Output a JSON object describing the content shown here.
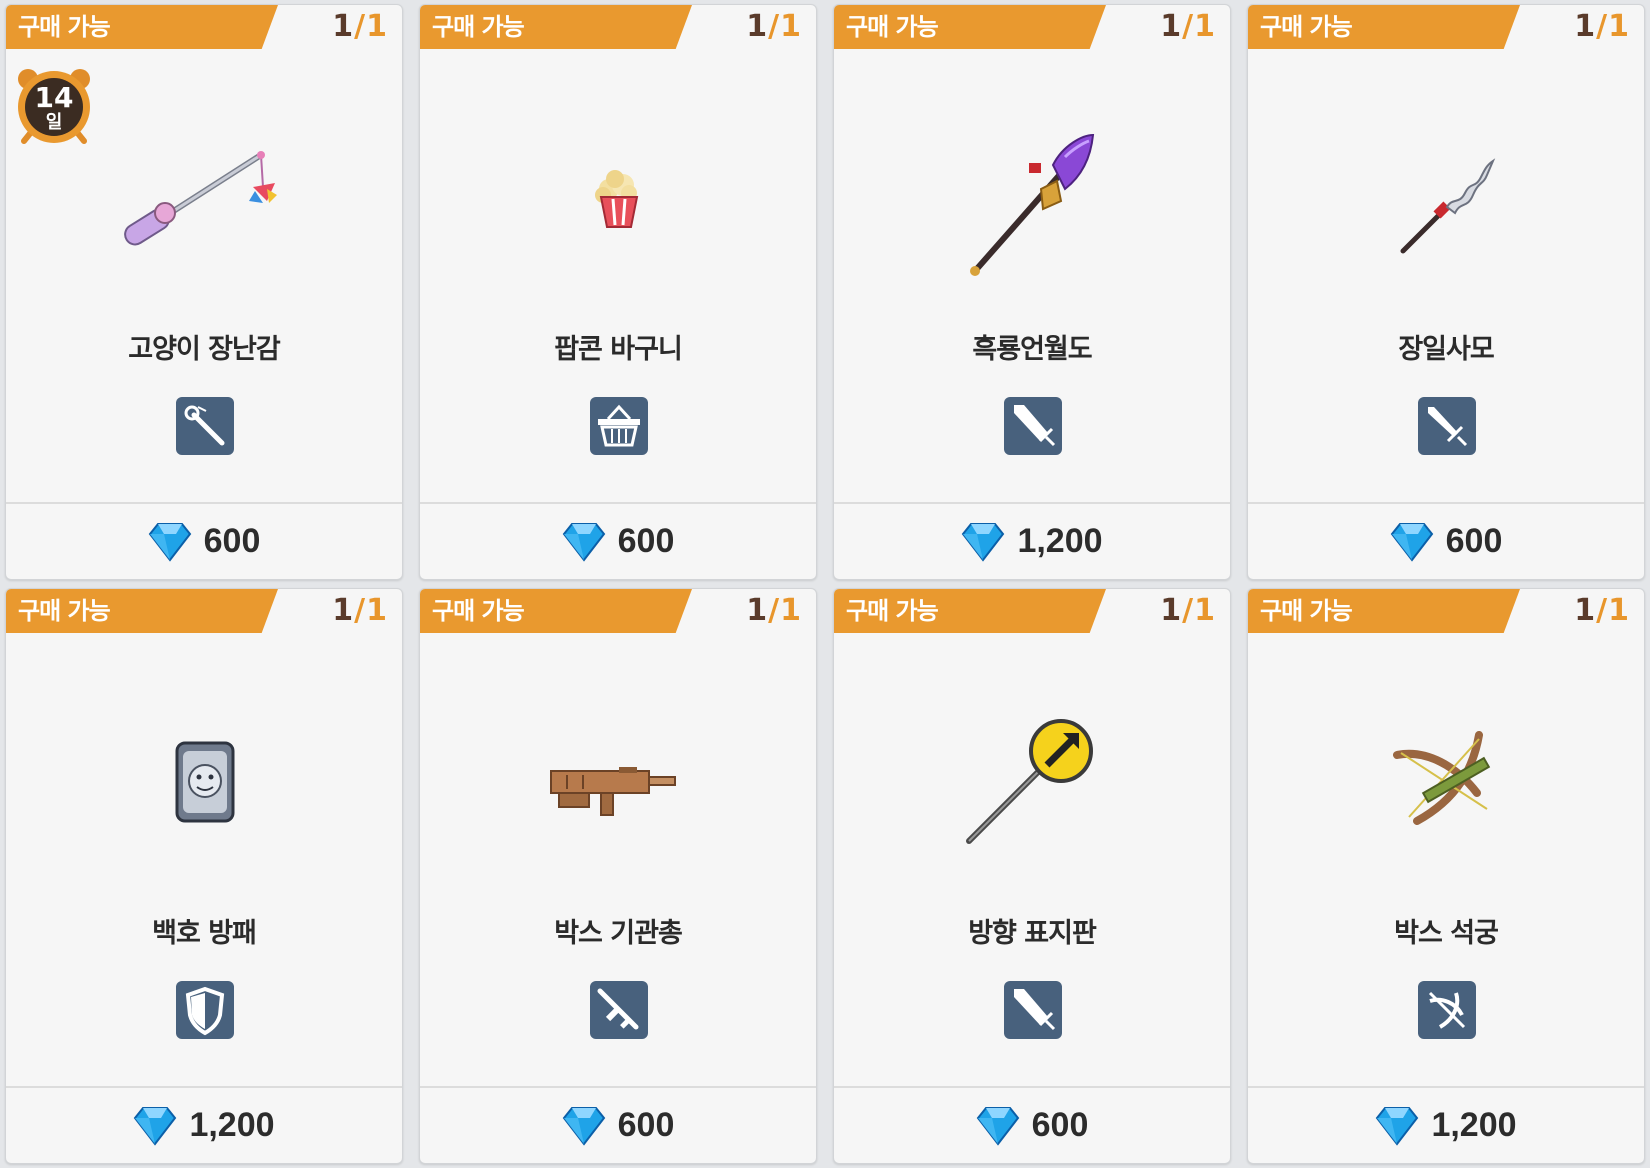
{
  "items": [
    {
      "badge": "구매 가능",
      "count_current": "1",
      "count_sep": "/",
      "count_max": "1",
      "name": "고양이 장난감",
      "price": "600",
      "type_icon": "fishing-rod-icon",
      "art_icon": "cat-toy-fishing-rod-icon",
      "timer": {
        "days": "14",
        "unit": "일"
      }
    },
    {
      "badge": "구매 가능",
      "count_current": "1",
      "count_sep": "/",
      "count_max": "1",
      "name": "팝콘 바구니",
      "price": "600",
      "type_icon": "basket-icon",
      "art_icon": "popcorn-bucket-icon"
    },
    {
      "badge": "구매 가능",
      "count_current": "1",
      "count_sep": "/",
      "count_max": "1",
      "name": "흑룡언월도",
      "price": "1,200",
      "type_icon": "greatsword-icon",
      "art_icon": "glaive-icon"
    },
    {
      "badge": "구매 가능",
      "count_current": "1",
      "count_sep": "/",
      "count_max": "1",
      "name": "장일사모",
      "price": "600",
      "type_icon": "sword-icon",
      "art_icon": "serpent-spear-icon"
    },
    {
      "badge": "구매 가능",
      "count_current": "1",
      "count_sep": "/",
      "count_max": "1",
      "name": "백호 방패",
      "price": "1,200",
      "type_icon": "shield-icon",
      "art_icon": "white-tiger-shield-icon"
    },
    {
      "badge": "구매 가능",
      "count_current": "1",
      "count_sep": "/",
      "count_max": "1",
      "name": "박스 기관총",
      "price": "600",
      "type_icon": "rifle-icon",
      "art_icon": "box-machine-gun-icon"
    },
    {
      "badge": "구매 가능",
      "count_current": "1",
      "count_sep": "/",
      "count_max": "1",
      "name": "방향 표지판",
      "price": "600",
      "type_icon": "greatsword-icon",
      "art_icon": "direction-sign-icon"
    },
    {
      "badge": "구매 가능",
      "count_current": "1",
      "count_sep": "/",
      "count_max": "1",
      "name": "박스 석궁",
      "price": "1,200",
      "type_icon": "crossbow-icon",
      "art_icon": "box-crossbow-icon"
    }
  ],
  "currency_icon": "blue-diamond-icon",
  "colors": {
    "badge": "#e9992f",
    "count_current": "#5a3b2b",
    "count_max": "#e8962c",
    "type_icon_bg": "#48617d",
    "gem": "#1fa3e8"
  }
}
